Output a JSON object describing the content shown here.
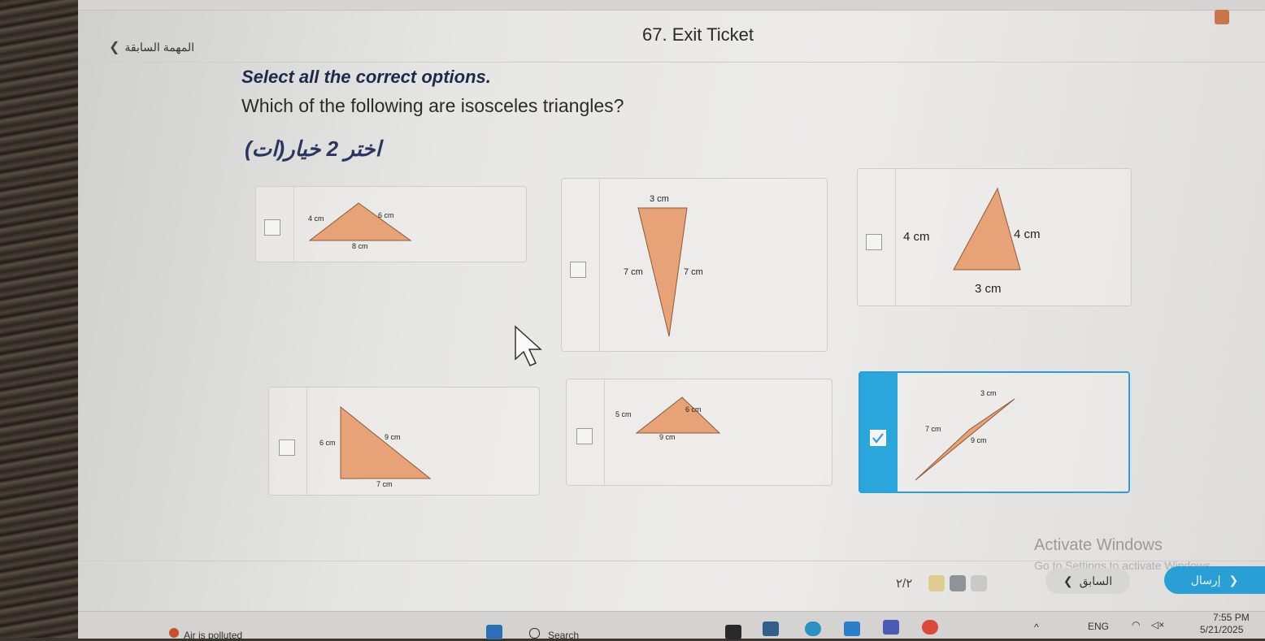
{
  "header": {
    "title": "67. Exit Ticket",
    "back_label": "المهمة السابقة"
  },
  "question": {
    "instruction": "Select all the correct options.",
    "text": "Which of the following are isosceles triangles?",
    "arabic_hint": "اختر 2 خيار(ات)"
  },
  "options": [
    {
      "labels": [
        "4 cm",
        "6 cm",
        "8 cm"
      ],
      "selected": false
    },
    {
      "labels": [
        "3 cm",
        "7 cm",
        "7 cm"
      ],
      "selected": false
    },
    {
      "labels": [
        "4 cm",
        "4 cm",
        "3 cm"
      ],
      "selected": false
    },
    {
      "labels": [
        "6 cm",
        "9 cm",
        "7 cm"
      ],
      "selected": false
    },
    {
      "labels": [
        "5 cm",
        "6 cm",
        "9 cm"
      ],
      "selected": false
    },
    {
      "labels": [
        "3 cm",
        "7 cm",
        "9 cm"
      ],
      "selected": true
    }
  ],
  "watermark": {
    "title": "Activate Windows",
    "subtitle": "Go to Settings to activate Windows."
  },
  "footer": {
    "page": "٢/٢",
    "prev_label": "السابق",
    "next_label": "إرسال"
  },
  "taskbar": {
    "weather": "Air is polluted",
    "search": "Search",
    "lang": "ENG",
    "time": "7:55 PM",
    "date": "5/21/2025"
  },
  "colors": {
    "accent": "#2a9fd6",
    "triangle_fill": "#e7a277"
  }
}
